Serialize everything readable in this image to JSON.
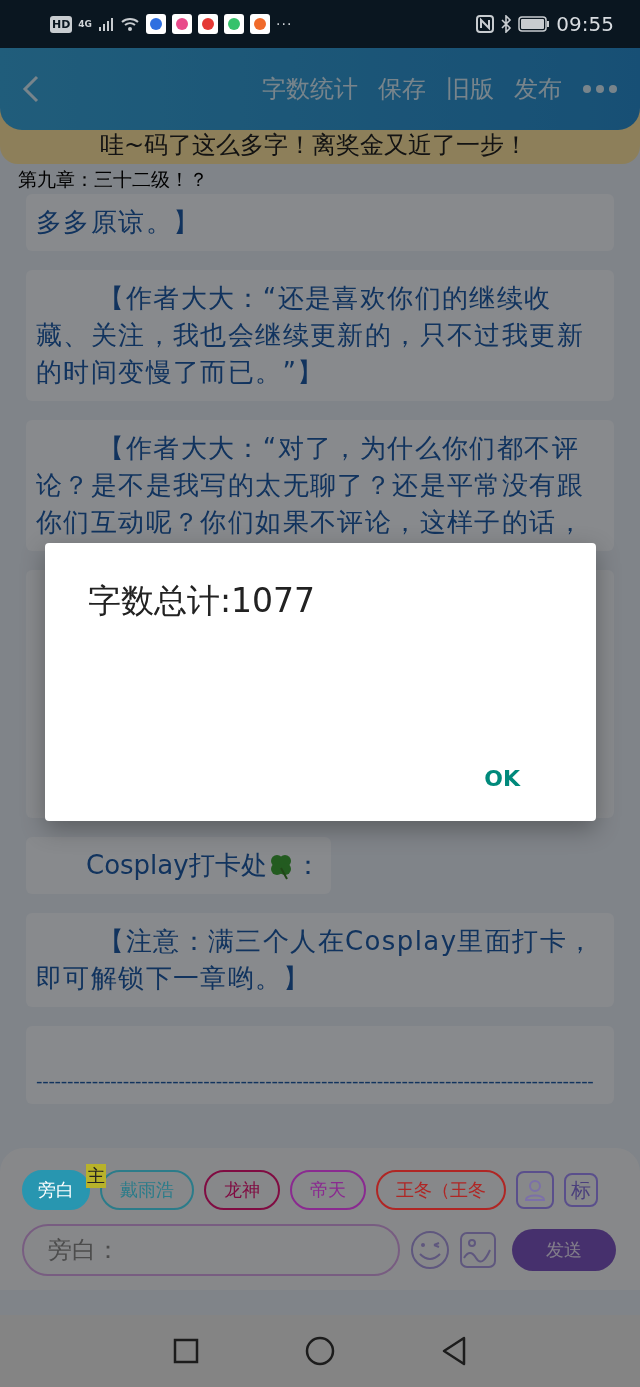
{
  "status_bar": {
    "hd": "HD",
    "network": "4G",
    "more": "···",
    "time": "09:55"
  },
  "header": {
    "actions": [
      "字数统计",
      "保存",
      "旧版",
      "发布"
    ]
  },
  "banner": "哇~码了这么多字！离奖金又近了一步！",
  "chapter_title": "第九章：三十二级！？",
  "messages": [
    {
      "kind": "text",
      "indent": false,
      "text": "多多原谅。】"
    },
    {
      "kind": "text",
      "indent": true,
      "text": "【作者大大：“还是喜欢你们的继续收藏、关注，我也会继续更新的，只不过我更新的时间变慢了而已。”】"
    },
    {
      "kind": "text",
      "indent": true,
      "text": "【作者大大：“对了，为什么你们都不评论？是不是我写的太无聊了？还是平常没有跟你们互动呢？你们如果不评论，这样子的话，"
    },
    {
      "kind": "covered"
    },
    {
      "kind": "checkin",
      "label": "Cosplay打卡处",
      "suffix": "："
    },
    {
      "kind": "text",
      "indent": true,
      "text": "【注意：满三个人在Cosplay里面打卡，即可解锁下一章哟。】"
    },
    {
      "kind": "divider",
      "text": "------------------------------------------------------------------------------------------"
    }
  ],
  "roles": [
    {
      "label": "旁白",
      "selected": true,
      "color": "#2896b0"
    },
    {
      "label": "戴雨浩",
      "selected": false,
      "color": "#2b7c8a",
      "badge": "主"
    },
    {
      "label": "龙神",
      "selected": false,
      "color": "#800c42"
    },
    {
      "label": "帝天",
      "selected": false,
      "color": "#8a2a90"
    },
    {
      "label": "王冬（王冬",
      "selected": false,
      "color": "#b02624"
    }
  ],
  "tag_button": "标",
  "input": {
    "placeholder": "旁白："
  },
  "send": "发送",
  "dialog": {
    "message": "字数总计:1077",
    "button": "OK"
  }
}
